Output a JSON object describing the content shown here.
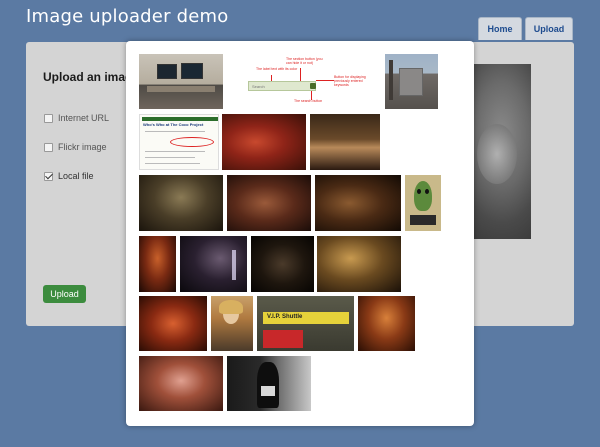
{
  "header": {
    "title": "Image uploader demo",
    "nav": [
      {
        "label": "Home"
      },
      {
        "label": "Upload"
      }
    ]
  },
  "panel": {
    "heading": "Upload an image",
    "options": [
      {
        "label": "Internet URL",
        "checked": false
      },
      {
        "label": "Flickr image",
        "checked": false
      },
      {
        "label": "Local file",
        "checked": true
      }
    ],
    "upload_label": "Upload"
  },
  "gallery": {
    "annotated_screenshot": {
      "label_text": "The label text with its color",
      "section_button": "The section button (you can hide it or not)",
      "display_button": "Button for displaying previously entered keywords",
      "search_button": "The search button",
      "search_placeholder": "Search"
    },
    "doc_title": "Who's Who at The Coco Project",
    "sign_text": "V.I.P. Shuttle"
  },
  "colors": {
    "background": "#5b7aa3",
    "panel": "#d4d4d4",
    "upload_button": "#3c8c3e",
    "nav_text": "#1e4c8f"
  }
}
